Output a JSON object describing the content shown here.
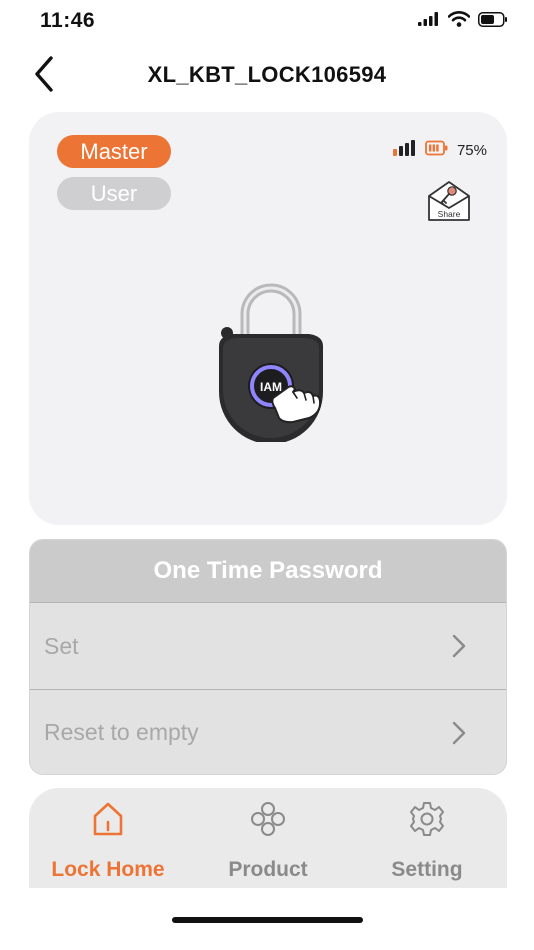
{
  "status_bar": {
    "time": "11:46",
    "icons": [
      "cellular-signal-icon",
      "wifi-icon",
      "battery-icon"
    ]
  },
  "nav": {
    "title": "XL_KBT_LOCK106594",
    "back_icon": "chevron-left-icon"
  },
  "lock_card": {
    "roles": [
      {
        "label": "Master",
        "active": true,
        "color": "#ec7434"
      },
      {
        "label": "User",
        "active": false,
        "color": "#cfcfd1"
      }
    ],
    "signal_icon": "signal-strength-icon",
    "battery_icon": "battery-level-icon",
    "battery_level": 0.75,
    "battery_text": "75%",
    "share": {
      "icon": "share-envelope-key-icon",
      "label": "Share"
    },
    "lock_image": {
      "icon": "padlock-fingerprint-icon",
      "badge": "IAM"
    }
  },
  "otp": {
    "title": "One Time Password",
    "rows": [
      {
        "label": "Set",
        "icon": "chevron-right-icon"
      },
      {
        "label": "Reset to empty",
        "icon": "chevron-right-icon"
      }
    ]
  },
  "tab_bar": {
    "tabs": [
      {
        "label": "Lock Home",
        "icon": "home-icon",
        "active": true
      },
      {
        "label": "Product",
        "icon": "product-clover-icon",
        "active": false
      },
      {
        "label": "Setting",
        "icon": "gear-icon",
        "active": false
      }
    ]
  },
  "colors": {
    "accent": "#ec7434",
    "inactive_text": "#a8a8a8",
    "tab_inactive": "#8a8a8a",
    "card_bg": "#f2f2f4"
  }
}
